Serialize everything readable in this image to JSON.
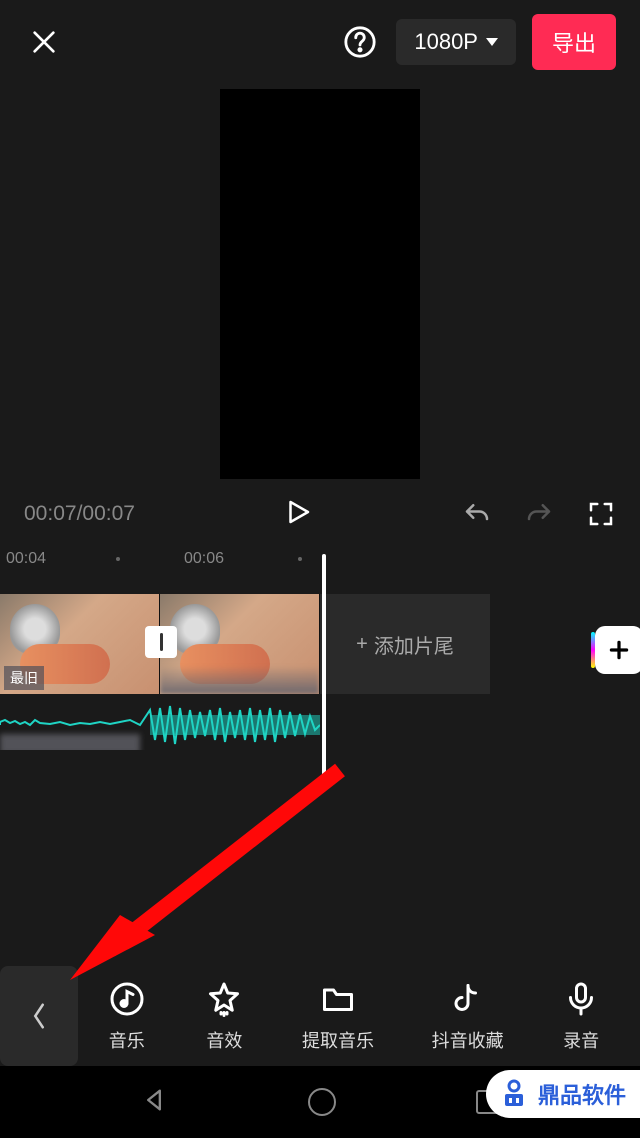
{
  "header": {
    "resolution_label": "1080P",
    "export_label": "导出"
  },
  "playback": {
    "current_time": "00:07",
    "total_time": "00:07"
  },
  "timeline": {
    "ticks": [
      "00:04",
      "00:06"
    ],
    "add_ending_label": "添加片尾"
  },
  "toolbar": {
    "music": "音乐",
    "sfx": "音效",
    "extract": "提取音乐",
    "douyin_fav": "抖音收藏",
    "record": "录音"
  },
  "watermark": {
    "brand": "鼎品软件"
  }
}
